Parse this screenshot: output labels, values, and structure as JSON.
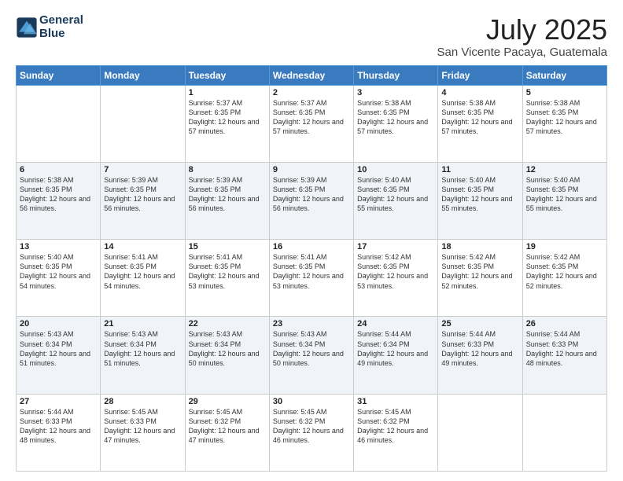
{
  "logo": {
    "line1": "General",
    "line2": "Blue"
  },
  "title": "July 2025",
  "subtitle": "San Vicente Pacaya, Guatemala",
  "days_of_week": [
    "Sunday",
    "Monday",
    "Tuesday",
    "Wednesday",
    "Thursday",
    "Friday",
    "Saturday"
  ],
  "weeks": [
    [
      {
        "day": "",
        "sunrise": "",
        "sunset": "",
        "daylight": ""
      },
      {
        "day": "",
        "sunrise": "",
        "sunset": "",
        "daylight": ""
      },
      {
        "day": "1",
        "sunrise": "Sunrise: 5:37 AM",
        "sunset": "Sunset: 6:35 PM",
        "daylight": "Daylight: 12 hours and 57 minutes."
      },
      {
        "day": "2",
        "sunrise": "Sunrise: 5:37 AM",
        "sunset": "Sunset: 6:35 PM",
        "daylight": "Daylight: 12 hours and 57 minutes."
      },
      {
        "day": "3",
        "sunrise": "Sunrise: 5:38 AM",
        "sunset": "Sunset: 6:35 PM",
        "daylight": "Daylight: 12 hours and 57 minutes."
      },
      {
        "day": "4",
        "sunrise": "Sunrise: 5:38 AM",
        "sunset": "Sunset: 6:35 PM",
        "daylight": "Daylight: 12 hours and 57 minutes."
      },
      {
        "day": "5",
        "sunrise": "Sunrise: 5:38 AM",
        "sunset": "Sunset: 6:35 PM",
        "daylight": "Daylight: 12 hours and 57 minutes."
      }
    ],
    [
      {
        "day": "6",
        "sunrise": "Sunrise: 5:38 AM",
        "sunset": "Sunset: 6:35 PM",
        "daylight": "Daylight: 12 hours and 56 minutes."
      },
      {
        "day": "7",
        "sunrise": "Sunrise: 5:39 AM",
        "sunset": "Sunset: 6:35 PM",
        "daylight": "Daylight: 12 hours and 56 minutes."
      },
      {
        "day": "8",
        "sunrise": "Sunrise: 5:39 AM",
        "sunset": "Sunset: 6:35 PM",
        "daylight": "Daylight: 12 hours and 56 minutes."
      },
      {
        "day": "9",
        "sunrise": "Sunrise: 5:39 AM",
        "sunset": "Sunset: 6:35 PM",
        "daylight": "Daylight: 12 hours and 56 minutes."
      },
      {
        "day": "10",
        "sunrise": "Sunrise: 5:40 AM",
        "sunset": "Sunset: 6:35 PM",
        "daylight": "Daylight: 12 hours and 55 minutes."
      },
      {
        "day": "11",
        "sunrise": "Sunrise: 5:40 AM",
        "sunset": "Sunset: 6:35 PM",
        "daylight": "Daylight: 12 hours and 55 minutes."
      },
      {
        "day": "12",
        "sunrise": "Sunrise: 5:40 AM",
        "sunset": "Sunset: 6:35 PM",
        "daylight": "Daylight: 12 hours and 55 minutes."
      }
    ],
    [
      {
        "day": "13",
        "sunrise": "Sunrise: 5:40 AM",
        "sunset": "Sunset: 6:35 PM",
        "daylight": "Daylight: 12 hours and 54 minutes."
      },
      {
        "day": "14",
        "sunrise": "Sunrise: 5:41 AM",
        "sunset": "Sunset: 6:35 PM",
        "daylight": "Daylight: 12 hours and 54 minutes."
      },
      {
        "day": "15",
        "sunrise": "Sunrise: 5:41 AM",
        "sunset": "Sunset: 6:35 PM",
        "daylight": "Daylight: 12 hours and 53 minutes."
      },
      {
        "day": "16",
        "sunrise": "Sunrise: 5:41 AM",
        "sunset": "Sunset: 6:35 PM",
        "daylight": "Daylight: 12 hours and 53 minutes."
      },
      {
        "day": "17",
        "sunrise": "Sunrise: 5:42 AM",
        "sunset": "Sunset: 6:35 PM",
        "daylight": "Daylight: 12 hours and 53 minutes."
      },
      {
        "day": "18",
        "sunrise": "Sunrise: 5:42 AM",
        "sunset": "Sunset: 6:35 PM",
        "daylight": "Daylight: 12 hours and 52 minutes."
      },
      {
        "day": "19",
        "sunrise": "Sunrise: 5:42 AM",
        "sunset": "Sunset: 6:35 PM",
        "daylight": "Daylight: 12 hours and 52 minutes."
      }
    ],
    [
      {
        "day": "20",
        "sunrise": "Sunrise: 5:43 AM",
        "sunset": "Sunset: 6:34 PM",
        "daylight": "Daylight: 12 hours and 51 minutes."
      },
      {
        "day": "21",
        "sunrise": "Sunrise: 5:43 AM",
        "sunset": "Sunset: 6:34 PM",
        "daylight": "Daylight: 12 hours and 51 minutes."
      },
      {
        "day": "22",
        "sunrise": "Sunrise: 5:43 AM",
        "sunset": "Sunset: 6:34 PM",
        "daylight": "Daylight: 12 hours and 50 minutes."
      },
      {
        "day": "23",
        "sunrise": "Sunrise: 5:43 AM",
        "sunset": "Sunset: 6:34 PM",
        "daylight": "Daylight: 12 hours and 50 minutes."
      },
      {
        "day": "24",
        "sunrise": "Sunrise: 5:44 AM",
        "sunset": "Sunset: 6:34 PM",
        "daylight": "Daylight: 12 hours and 49 minutes."
      },
      {
        "day": "25",
        "sunrise": "Sunrise: 5:44 AM",
        "sunset": "Sunset: 6:33 PM",
        "daylight": "Daylight: 12 hours and 49 minutes."
      },
      {
        "day": "26",
        "sunrise": "Sunrise: 5:44 AM",
        "sunset": "Sunset: 6:33 PM",
        "daylight": "Daylight: 12 hours and 48 minutes."
      }
    ],
    [
      {
        "day": "27",
        "sunrise": "Sunrise: 5:44 AM",
        "sunset": "Sunset: 6:33 PM",
        "daylight": "Daylight: 12 hours and 48 minutes."
      },
      {
        "day": "28",
        "sunrise": "Sunrise: 5:45 AM",
        "sunset": "Sunset: 6:33 PM",
        "daylight": "Daylight: 12 hours and 47 minutes."
      },
      {
        "day": "29",
        "sunrise": "Sunrise: 5:45 AM",
        "sunset": "Sunset: 6:32 PM",
        "daylight": "Daylight: 12 hours and 47 minutes."
      },
      {
        "day": "30",
        "sunrise": "Sunrise: 5:45 AM",
        "sunset": "Sunset: 6:32 PM",
        "daylight": "Daylight: 12 hours and 46 minutes."
      },
      {
        "day": "31",
        "sunrise": "Sunrise: 5:45 AM",
        "sunset": "Sunset: 6:32 PM",
        "daylight": "Daylight: 12 hours and 46 minutes."
      },
      {
        "day": "",
        "sunrise": "",
        "sunset": "",
        "daylight": ""
      },
      {
        "day": "",
        "sunrise": "",
        "sunset": "",
        "daylight": ""
      }
    ]
  ]
}
